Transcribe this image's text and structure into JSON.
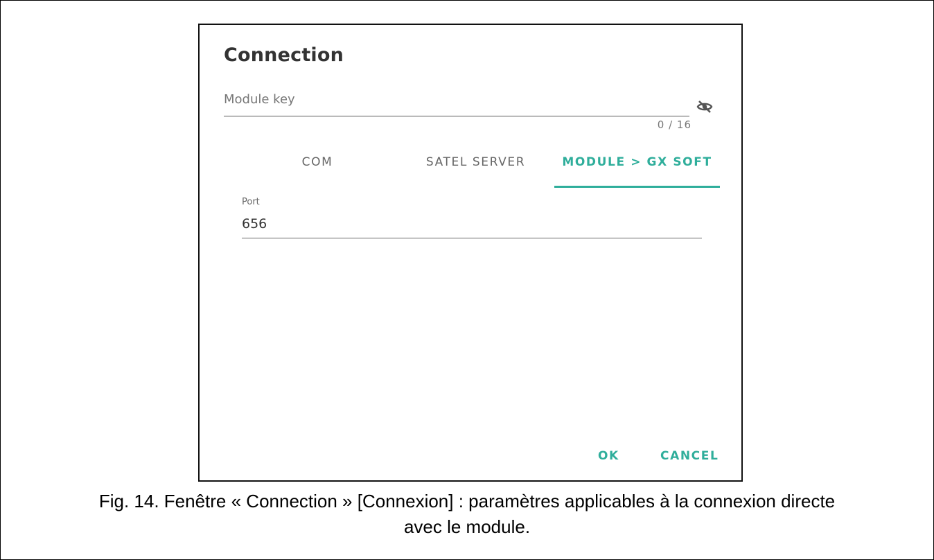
{
  "dialog": {
    "title": "Connection",
    "module_key": {
      "placeholder": "Module key",
      "value": "",
      "counter": "0 / 16",
      "visibility_icon": "eye-off-icon"
    },
    "tabs": [
      {
        "label": "COM",
        "active": false
      },
      {
        "label": "SATEL SERVER",
        "active": false
      },
      {
        "label": "MODULE > GX SOFT",
        "active": true
      }
    ],
    "port": {
      "label": "Port",
      "value": "656"
    },
    "buttons": {
      "ok": "OK",
      "cancel": "CANCEL"
    }
  },
  "caption": {
    "line1": "Fig. 14. Fenêtre « Connection » [Connexion] : paramètres applicables à la connexion directe",
    "line2": "avec le module."
  },
  "colors": {
    "accent": "#2fae9b",
    "text": "#333333",
    "muted": "#777777"
  }
}
